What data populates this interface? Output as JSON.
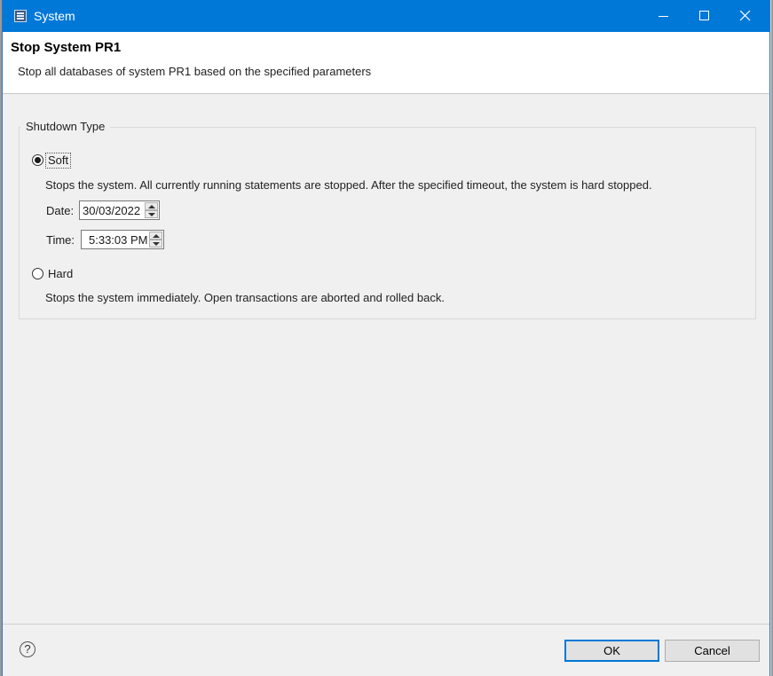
{
  "window": {
    "title": "System",
    "app_icon": "system-window-icon",
    "controls": [
      "minimize-icon",
      "maximize-icon",
      "close-icon"
    ]
  },
  "header": {
    "title": "Stop System PR1",
    "description": "Stop all databases of system PR1 based on the specified parameters"
  },
  "shutdown": {
    "group_label": "Shutdown Type",
    "soft": {
      "label": "Soft",
      "selected": true,
      "description": "Stops the system. All currently running statements are stopped. After the specified timeout, the system is hard stopped.",
      "date_label": "Date:",
      "date_value": "30/03/2022",
      "time_label": "Time:",
      "time_value": "5:33:03 PM"
    },
    "hard": {
      "label": "Hard",
      "selected": false,
      "description": "Stops the system immediately. Open transactions are aborted and rolled back."
    }
  },
  "footer": {
    "help_glyph": "?",
    "ok_label": "OK",
    "cancel_label": "Cancel"
  },
  "colors": {
    "titlebar": "#0078d7",
    "dialog_bg": "#f0f0f0",
    "header_bg": "#ffffff",
    "default_button_border": "#0078d7"
  }
}
